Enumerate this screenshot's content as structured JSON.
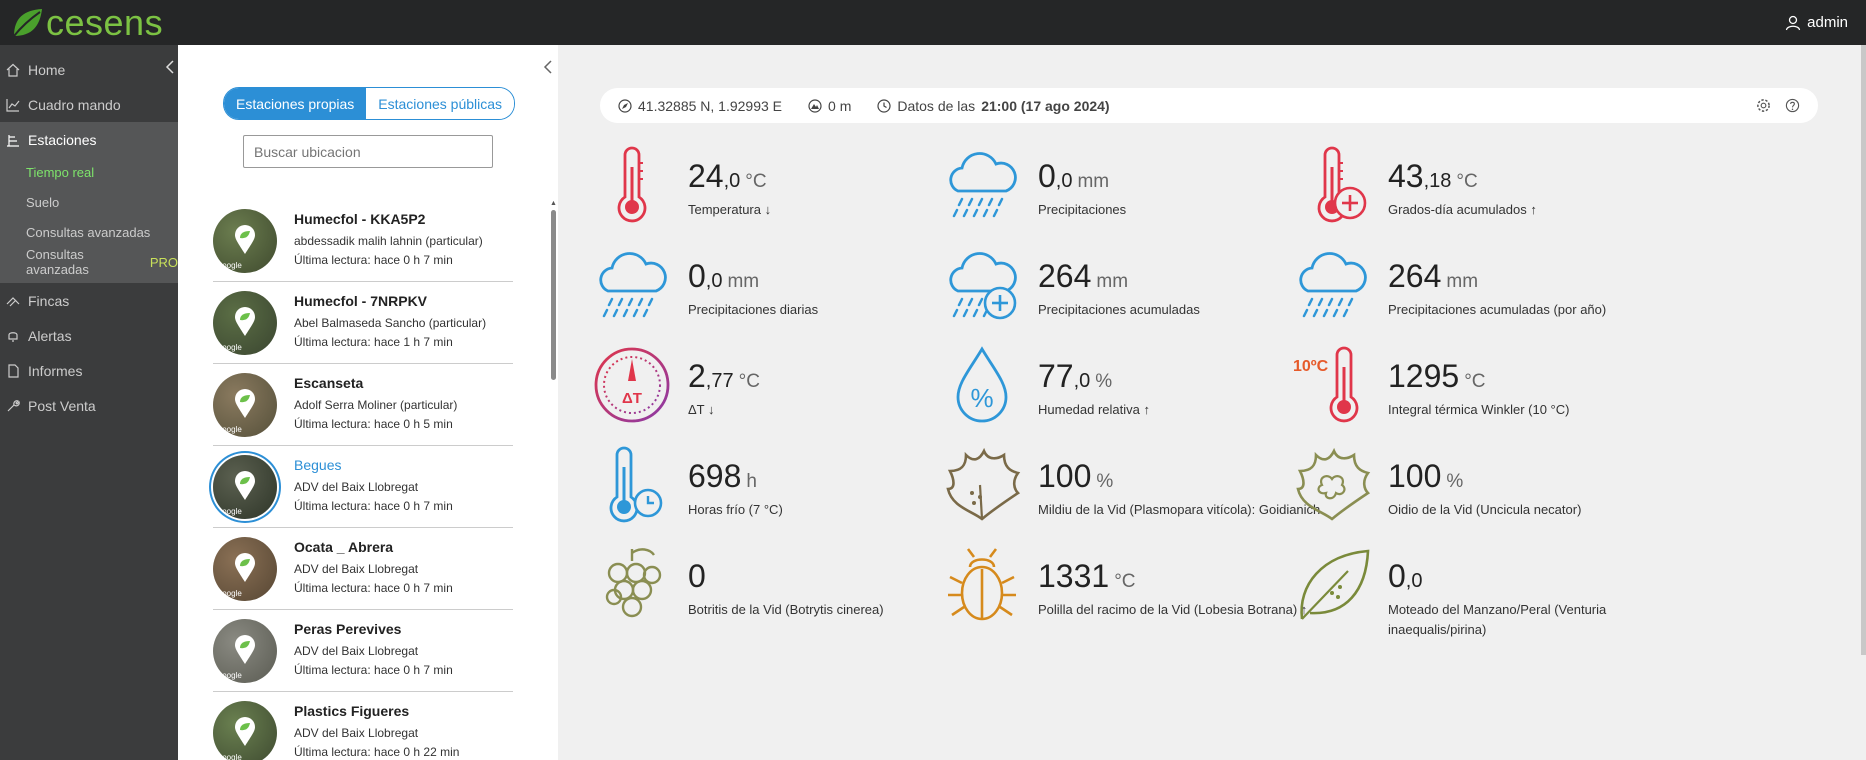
{
  "brand": {
    "name": "cesens",
    "accent": "#7cc243"
  },
  "user": {
    "name": "admin"
  },
  "sidebar": {
    "items": [
      {
        "label": "Home"
      },
      {
        "label": "Cuadro mando"
      },
      {
        "label": "Estaciones"
      },
      {
        "label": "Fincas"
      },
      {
        "label": "Alertas"
      },
      {
        "label": "Informes"
      },
      {
        "label": "Post Venta"
      }
    ],
    "sub": [
      {
        "label": "Tiempo real"
      },
      {
        "label": "Suelo"
      },
      {
        "label": "Consultas avanzadas"
      },
      {
        "label": "Consultas avanzadas",
        "badge": "PRO"
      }
    ]
  },
  "stations_panel": {
    "tab_own": "Estaciones propias",
    "tab_public": "Estaciones públicas",
    "search_placeholder": "Buscar ubicacion",
    "thumb_watermark": "Google",
    "stations": [
      {
        "name": "Humecfol - KKA5P2",
        "owner": "abdessadik malih lahnin (particular)",
        "reading": "Última lectura: hace 0 h 7 min"
      },
      {
        "name": "Humecfol - 7NRPKV",
        "owner": "Abel Balmaseda Sancho (particular)",
        "reading": "Última lectura: hace 1 h 7 min"
      },
      {
        "name": "Escanseta",
        "owner": "Adolf Serra Moliner (particular)",
        "reading": "Última lectura: hace 0 h 5 min"
      },
      {
        "name": "Begues",
        "owner": "ADV del Baix Llobregat",
        "reading": "Última lectura: hace 0 h 7 min"
      },
      {
        "name": "Ocata _ Abrera",
        "owner": "ADV del Baix Llobregat",
        "reading": "Última lectura: hace 0 h 7 min"
      },
      {
        "name": "Peras Perevives",
        "owner": "ADV del Baix Llobregat",
        "reading": "Última lectura: hace 0 h 7 min"
      },
      {
        "name": "Plastics Figueres",
        "owner": "ADV del Baix Llobregat",
        "reading": "Última lectura: hace 0 h 22 min"
      }
    ]
  },
  "infobar": {
    "coords": "41.32885 N, 1.92993 E",
    "altitude": "0 m",
    "data_prefix": "Datos de las",
    "data_time": "21:00 (17 ago 2024)"
  },
  "metrics": [
    {
      "int": "24",
      "dec": ",0",
      "unit": "°C",
      "label": "Temperatura ↓"
    },
    {
      "int": "0",
      "dec": ",0",
      "unit": "mm",
      "label": "Precipitaciones"
    },
    {
      "int": "43",
      "dec": ",18",
      "unit": "°C",
      "label": "Grados-día acumulados ↑"
    },
    {
      "int": "0",
      "dec": ",0",
      "unit": "mm",
      "label": "Precipitaciones diarias"
    },
    {
      "int": "264",
      "dec": "",
      "unit": "mm",
      "label": "Precipitaciones acumuladas"
    },
    {
      "int": "264",
      "dec": "",
      "unit": "mm",
      "label": "Precipitaciones acumuladas (por año)"
    },
    {
      "int": "2",
      "dec": ",77",
      "unit": "°C",
      "label": "ΔT ↓"
    },
    {
      "int": "77",
      "dec": ",0",
      "unit": "%",
      "label": "Humedad relativa ↑"
    },
    {
      "int": "1295",
      "dec": "",
      "unit": "°C",
      "label": "Integral térmica Winkler (10 °C)"
    },
    {
      "int": "698",
      "dec": "",
      "unit": "h",
      "label": "Horas frío (7 °C)"
    },
    {
      "int": "100",
      "dec": "",
      "unit": "%",
      "label": "Mildiu de la Vid (Plasmopara vitícola): Goidianich"
    },
    {
      "int": "100",
      "dec": "",
      "unit": "%",
      "label": "Oidio de la Vid (Uncicula necator)"
    },
    {
      "int": "0",
      "dec": "",
      "unit": "",
      "label": "Botritis de la Vid (Botrytis cinerea)"
    },
    {
      "int": "1331",
      "dec": "",
      "unit": "°C",
      "label": "Polilla del racimo de la Vid (Lobesia Botrana) ↑"
    },
    {
      "int": "0",
      "dec": ",0",
      "unit": "",
      "label": "Moteado del Manzano/Peral (Venturia inaequalis/pirina)"
    }
  ],
  "icon_texts": {
    "delta_t": "ΔT",
    "winkler": "10ºC"
  },
  "icons": [
    "thermometer-icon",
    "rain-cloud-icon",
    "thermometer-plus-icon",
    "rain-cloud-icon",
    "rain-cloud-plus-icon",
    "rain-cloud-icon",
    "gauge-delta-t-icon",
    "humidity-drop-icon",
    "thermometer-10c-icon",
    "thermometer-clock-icon",
    "vine-leaf-icon",
    "vine-leaf-mildew-icon",
    "grapes-icon",
    "beetle-icon",
    "apple-leaf-icon"
  ]
}
